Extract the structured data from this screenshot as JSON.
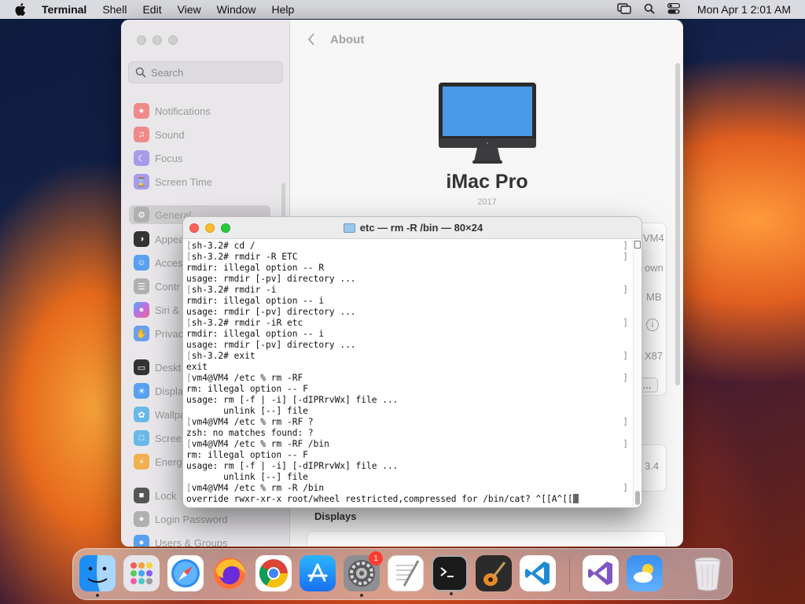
{
  "menubar": {
    "apple_icon": "apple-icon",
    "app_name": "Terminal",
    "menus": [
      "Shell",
      "Edit",
      "View",
      "Window",
      "Help"
    ],
    "status_icons": [
      "screen-mirroring-icon",
      "spotlight-search-icon",
      "control-center-icon"
    ],
    "clock": "Mon Apr 1  2:01 AM"
  },
  "settings": {
    "search_placeholder": "Search",
    "sidebar": [
      {
        "label": "Notifications",
        "icon": "bell-icon",
        "color": "#f08a8a"
      },
      {
        "label": "Sound",
        "icon": "speaker-icon",
        "color": "#f08a8a"
      },
      {
        "label": "Focus",
        "icon": "moon-icon",
        "color": "#a89ce8"
      },
      {
        "label": "Screen Time",
        "icon": "hourglass-icon",
        "color": "#a89ce8"
      },
      {
        "label": "General",
        "icon": "gear-icon",
        "color": "#b0b0b0"
      },
      {
        "label": "Appea",
        "icon": "appearance-icon",
        "color": "#333333"
      },
      {
        "label": "Acces",
        "icon": "accessibility-icon",
        "color": "#5aa0f0"
      },
      {
        "label": "Contr",
        "icon": "control-center-icon",
        "color": "#b0b0b0"
      },
      {
        "label": "Siri &",
        "icon": "siri-icon",
        "color": "#c070e0"
      },
      {
        "label": "Privac",
        "icon": "hand-icon",
        "color": "#6a9ef0"
      },
      {
        "label": "Deskt",
        "icon": "desktop-icon",
        "color": "#333333"
      },
      {
        "label": "Displa",
        "icon": "sun-icon",
        "color": "#5aa0f0"
      },
      {
        "label": "Wallpa",
        "icon": "wallpaper-icon",
        "color": "#6ab8e8"
      },
      {
        "label": "Scree",
        "icon": "screensaver-icon",
        "color": "#6ab8e8"
      },
      {
        "label": "Energ",
        "icon": "battery-icon",
        "color": "#f0b050"
      },
      {
        "label": "Lock",
        "icon": "lock-icon",
        "color": "#555555"
      },
      {
        "label": "Login Password",
        "icon": "key-icon",
        "color": "#b0b0b0"
      },
      {
        "label": "Users & Groups",
        "icon": "users-icon",
        "color": "#5aa0f0"
      }
    ],
    "pane_title": "About",
    "model_name": "iMac Pro",
    "model_year": "2017",
    "right_fragments": [
      "VM4",
      "own",
      "MB",
      "X87",
      "s...",
      "3.4"
    ],
    "displays_label": "Displays"
  },
  "terminal": {
    "title": "etc — rm -R /bin — 80×24",
    "lines": [
      {
        "text": "sh-3.2# cd /",
        "marked": true
      },
      {
        "text": "sh-3.2# rmdir -R ETC",
        "marked": true
      },
      {
        "text": "rmdir: illegal option -- R",
        "marked": false
      },
      {
        "text": "usage: rmdir [-pv] directory ...",
        "marked": false
      },
      {
        "text": "sh-3.2# rmdir -i",
        "marked": true
      },
      {
        "text": "rmdir: illegal option -- i",
        "marked": false
      },
      {
        "text": "usage: rmdir [-pv] directory ...",
        "marked": false
      },
      {
        "text": "sh-3.2# rmdir -iR etc",
        "marked": true
      },
      {
        "text": "rmdir: illegal option -- i",
        "marked": false
      },
      {
        "text": "usage: rmdir [-pv] directory ...",
        "marked": false
      },
      {
        "text": "sh-3.2# exit",
        "marked": true
      },
      {
        "text": "exit",
        "marked": false
      },
      {
        "text": "vm4@VM4 /etc % rm -RF",
        "marked": true
      },
      {
        "text": "rm: illegal option -- F",
        "marked": false
      },
      {
        "text": "usage: rm [-f | -i] [-dIPRrvWx] file ...",
        "marked": false
      },
      {
        "text": "       unlink [--] file",
        "marked": false
      },
      {
        "text": "vm4@VM4 /etc % rm -RF ?",
        "marked": true
      },
      {
        "text": "zsh: no matches found: ?",
        "marked": false
      },
      {
        "text": "vm4@VM4 /etc % rm -RF /bin",
        "marked": true
      },
      {
        "text": "rm: illegal option -- F",
        "marked": false
      },
      {
        "text": "usage: rm [-f | -i] [-dIPRrvWx] file ...",
        "marked": false
      },
      {
        "text": "       unlink [--] file",
        "marked": false
      },
      {
        "text": "vm4@VM4 /etc % rm -R /bin",
        "marked": true
      },
      {
        "text": "override rwxr-xr-x root/wheel restricted,compressed for /bin/cat? ^[[A^[[",
        "marked": false
      }
    ]
  },
  "dock": {
    "apps": [
      {
        "name": "Finder",
        "icon": "finder-icon",
        "running": true
      },
      {
        "name": "Launchpad",
        "icon": "launchpad-icon",
        "running": false
      },
      {
        "name": "Safari",
        "icon": "safari-icon",
        "running": false
      },
      {
        "name": "Firefox",
        "icon": "firefox-icon",
        "running": false
      },
      {
        "name": "Chrome",
        "icon": "chrome-icon",
        "running": false
      },
      {
        "name": "App Store",
        "icon": "app-store-icon",
        "running": false
      },
      {
        "name": "System Settings",
        "icon": "system-settings-icon",
        "running": true,
        "badge": "1"
      },
      {
        "name": "TextEdit",
        "icon": "textedit-icon",
        "running": false
      },
      {
        "name": "Terminal",
        "icon": "terminal-icon",
        "running": true
      },
      {
        "name": "GarageBand",
        "icon": "garageband-icon",
        "running": false
      },
      {
        "name": "Visual Studio Code",
        "icon": "vscode-icon",
        "running": false
      },
      {
        "name": "Visual Studio",
        "icon": "visual-studio-icon",
        "running": false
      },
      {
        "name": "Weather",
        "icon": "weather-icon",
        "running": false
      },
      {
        "name": "Trash",
        "icon": "trash-icon",
        "running": false
      }
    ]
  }
}
